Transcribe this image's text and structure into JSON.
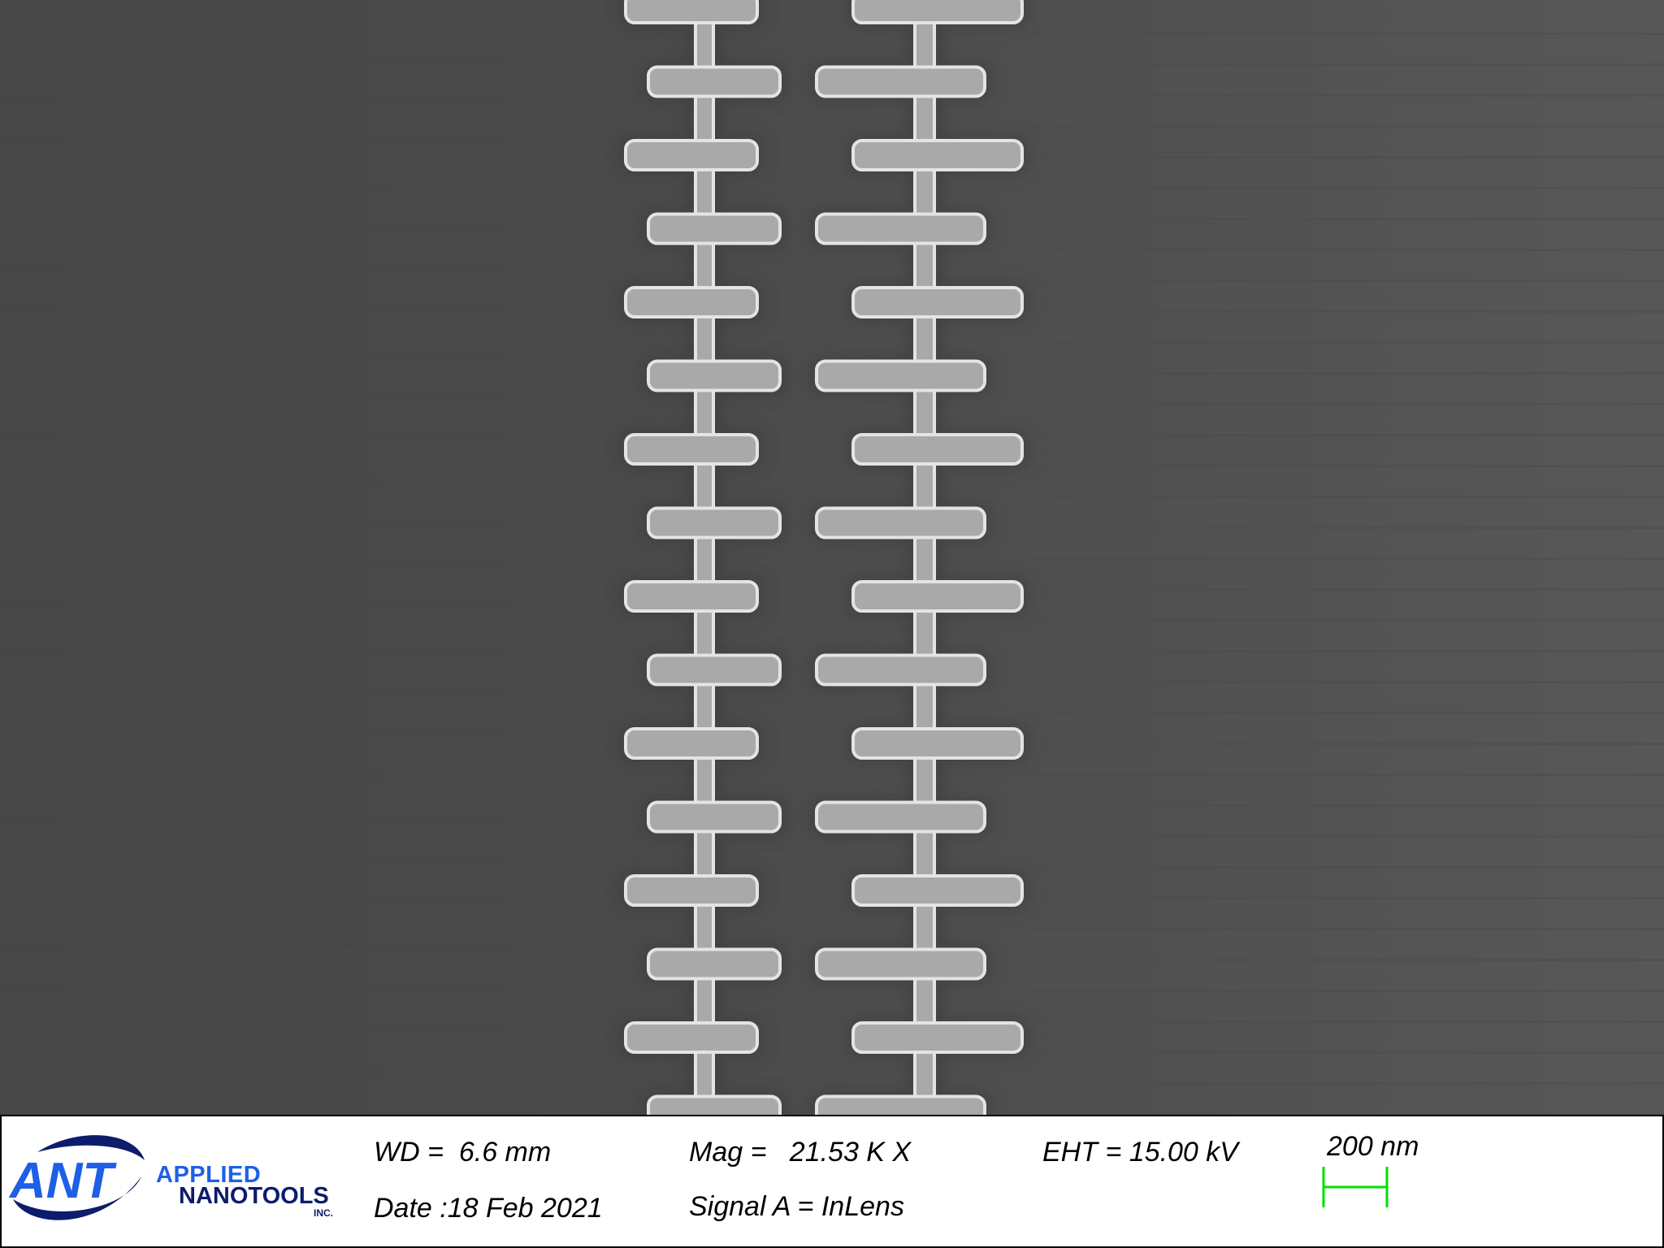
{
  "image": {
    "description_icon": "sem-micrograph",
    "colors": {
      "background_left": "#494949",
      "background_right": "#565656",
      "structure_fill": "#a9a9a9",
      "structure_edge": "#e4e4e4"
    },
    "structure": {
      "columns": 2,
      "fingers_per_column_visible": 15
    }
  },
  "logo": {
    "mark": "ANT",
    "line1": "APPLIED",
    "line2": "NANOTOOLS",
    "suffix": "INC.",
    "colors": {
      "primary": "#1e5fe6",
      "dark": "#0d1d6b"
    }
  },
  "metadata": {
    "wd": "WD =  6.6 mm",
    "date": "Date :18 Feb 2021",
    "mag": "Mag =   21.53 K X",
    "signal": "Signal A = InLens",
    "eht": "EHT = 15.00 kV",
    "scale_label": "200 nm",
    "scale_color": "#00e000"
  }
}
